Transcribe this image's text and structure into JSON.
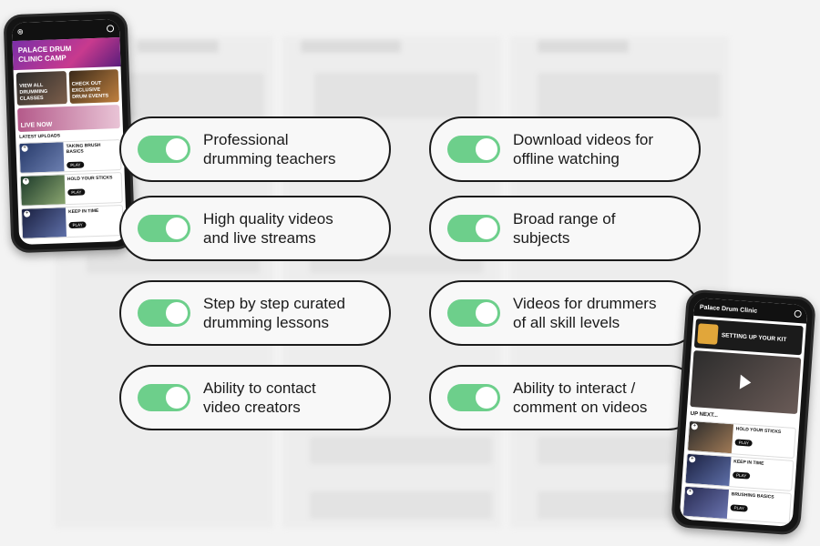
{
  "features": [
    {
      "label": "Professional\ndrumming teachers"
    },
    {
      "label": "Download videos for\noffline watching"
    },
    {
      "label": "High quality videos\nand live streams"
    },
    {
      "label": "Broad range of\nsubjects"
    },
    {
      "label": "Step by step curated\ndrumming lessons"
    },
    {
      "label": "Videos for drummers\nof all skill levels"
    },
    {
      "label": "Ability to contact\nvideo creators"
    },
    {
      "label": "Ability to interact /\ncomment on videos"
    }
  ],
  "colors": {
    "toggle_on": "#6dcf8b",
    "pill_border": "#1b1b1b",
    "pill_bg": "#f8f8f8"
  },
  "phone_left": {
    "hero_title": "PALACE DRUM\nCLINIC CAMP",
    "tile_1": "VIEW ALL\nDRUMMING\nCLASSES",
    "tile_2": "CHECK OUT\nEXCLUSIVE\nDRUM EVENTS",
    "live_label": "LIVE NOW",
    "section_title": "LATEST UPLOADS",
    "videos": [
      {
        "title": "TAKING BRUSH BASICS",
        "play": "PLAY"
      },
      {
        "title": "HOLD YOUR STICKS",
        "play": "PLAY"
      },
      {
        "title": "KEEP IN TIME",
        "play": "PLAY"
      }
    ]
  },
  "phone_right": {
    "header": "Palace Drum Clinic",
    "banner_title": "SETTING UP YOUR KIT",
    "up_next": "UP NEXT...",
    "videos": [
      {
        "title": "HOLD YOUR STICKS",
        "play": "PLAY"
      },
      {
        "title": "KEEP IN TIME",
        "play": "PLAY"
      },
      {
        "title": "BRUSHING BASICS",
        "play": "PLAY"
      }
    ]
  }
}
